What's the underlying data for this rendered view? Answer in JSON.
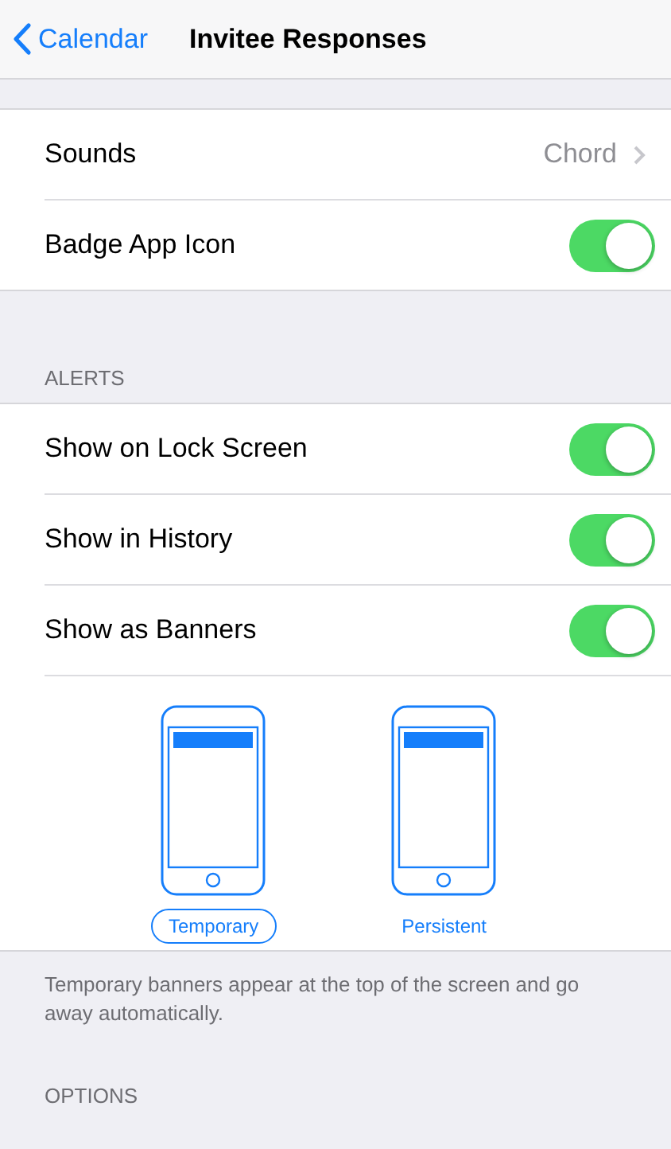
{
  "nav": {
    "back_label": "Calendar",
    "title": "Invitee Responses"
  },
  "top_rows": [
    {
      "kind": "value",
      "label": "Sounds",
      "value": "Chord"
    },
    {
      "kind": "toggle",
      "label": "Badge App Icon",
      "on": true
    }
  ],
  "alerts": {
    "header": "ALERTS",
    "rows": [
      {
        "label": "Show on Lock Screen",
        "on": true
      },
      {
        "label": "Show in History",
        "on": true
      },
      {
        "label": "Show as Banners",
        "on": true
      }
    ],
    "banner_styles": [
      {
        "label": "Temporary",
        "selected": true
      },
      {
        "label": "Persistent",
        "selected": false
      }
    ],
    "footer": "Temporary banners appear at the top of the screen and go away automatically."
  },
  "options_header": "OPTIONS"
}
